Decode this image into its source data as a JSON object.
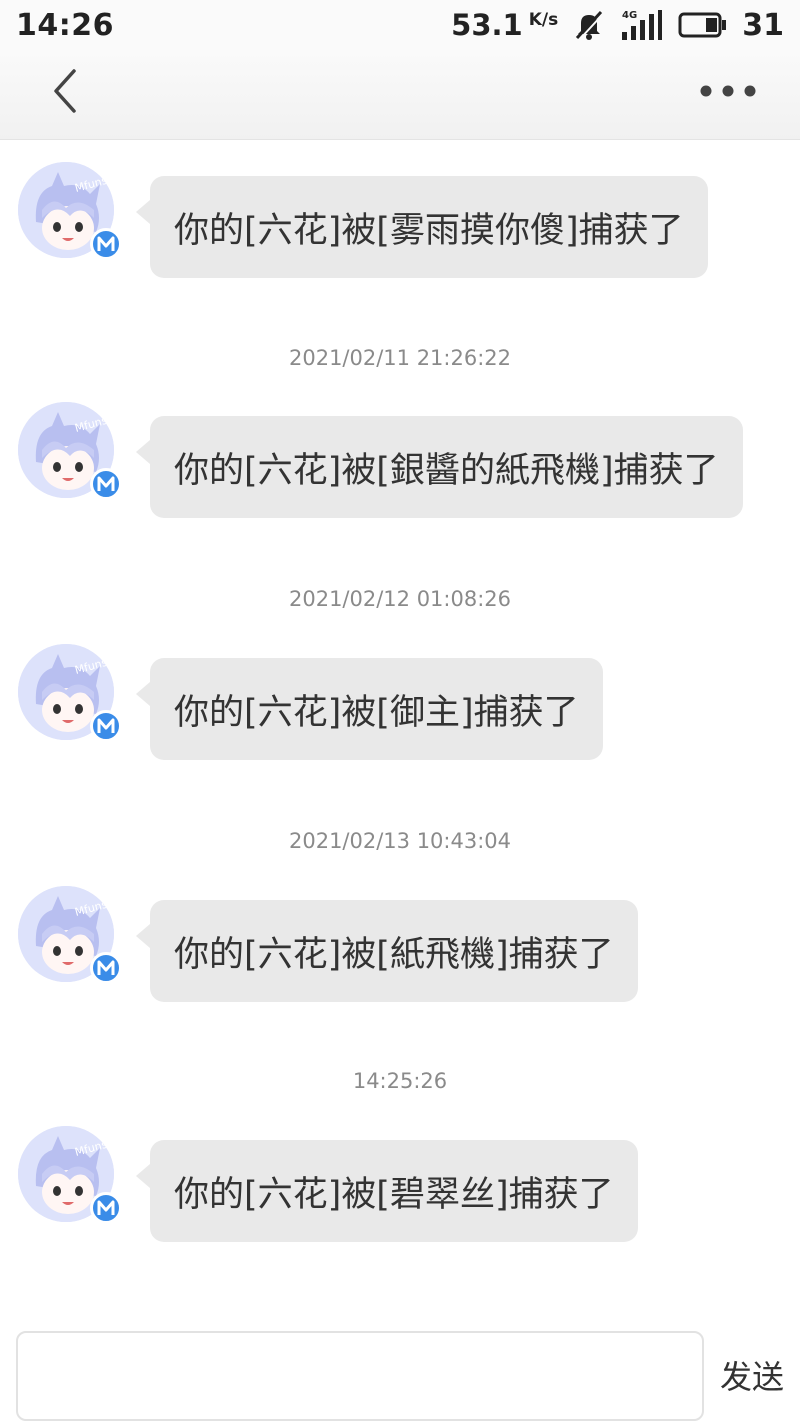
{
  "status_bar": {
    "time": "14:26",
    "network_speed": "53.1",
    "network_speed_unit": "K/s",
    "battery": "31",
    "icons": [
      "mute-bell-icon",
      "signal-4g-icon",
      "battery-icon"
    ]
  },
  "header": {
    "back_icon": "chevron-left-icon",
    "more_icon": "more-dots-icon"
  },
  "messages": [
    {
      "text": "你的[六花]被[雾雨摸你傻]捕获了",
      "timestamp": ""
    },
    {
      "text": "你的[六花]被[銀醬的紙飛機]捕获了",
      "timestamp": "2021/02/11 21:26:22"
    },
    {
      "text": "你的[六花]被[御主]捕获了",
      "timestamp": "2021/02/12 01:08:26"
    },
    {
      "text": "你的[六花]被[紙飛機]捕获了",
      "timestamp": "2021/02/13 10:43:04"
    },
    {
      "text": "你的[六花]被[碧翠丝]捕获了",
      "timestamp": "14:25:26"
    }
  ],
  "input": {
    "value": "",
    "placeholder": "",
    "send_label": "发送"
  },
  "colors": {
    "bubble": "#e9e9e9",
    "badge": "#3a8ce8",
    "timestamp": "#8a8a8a"
  }
}
